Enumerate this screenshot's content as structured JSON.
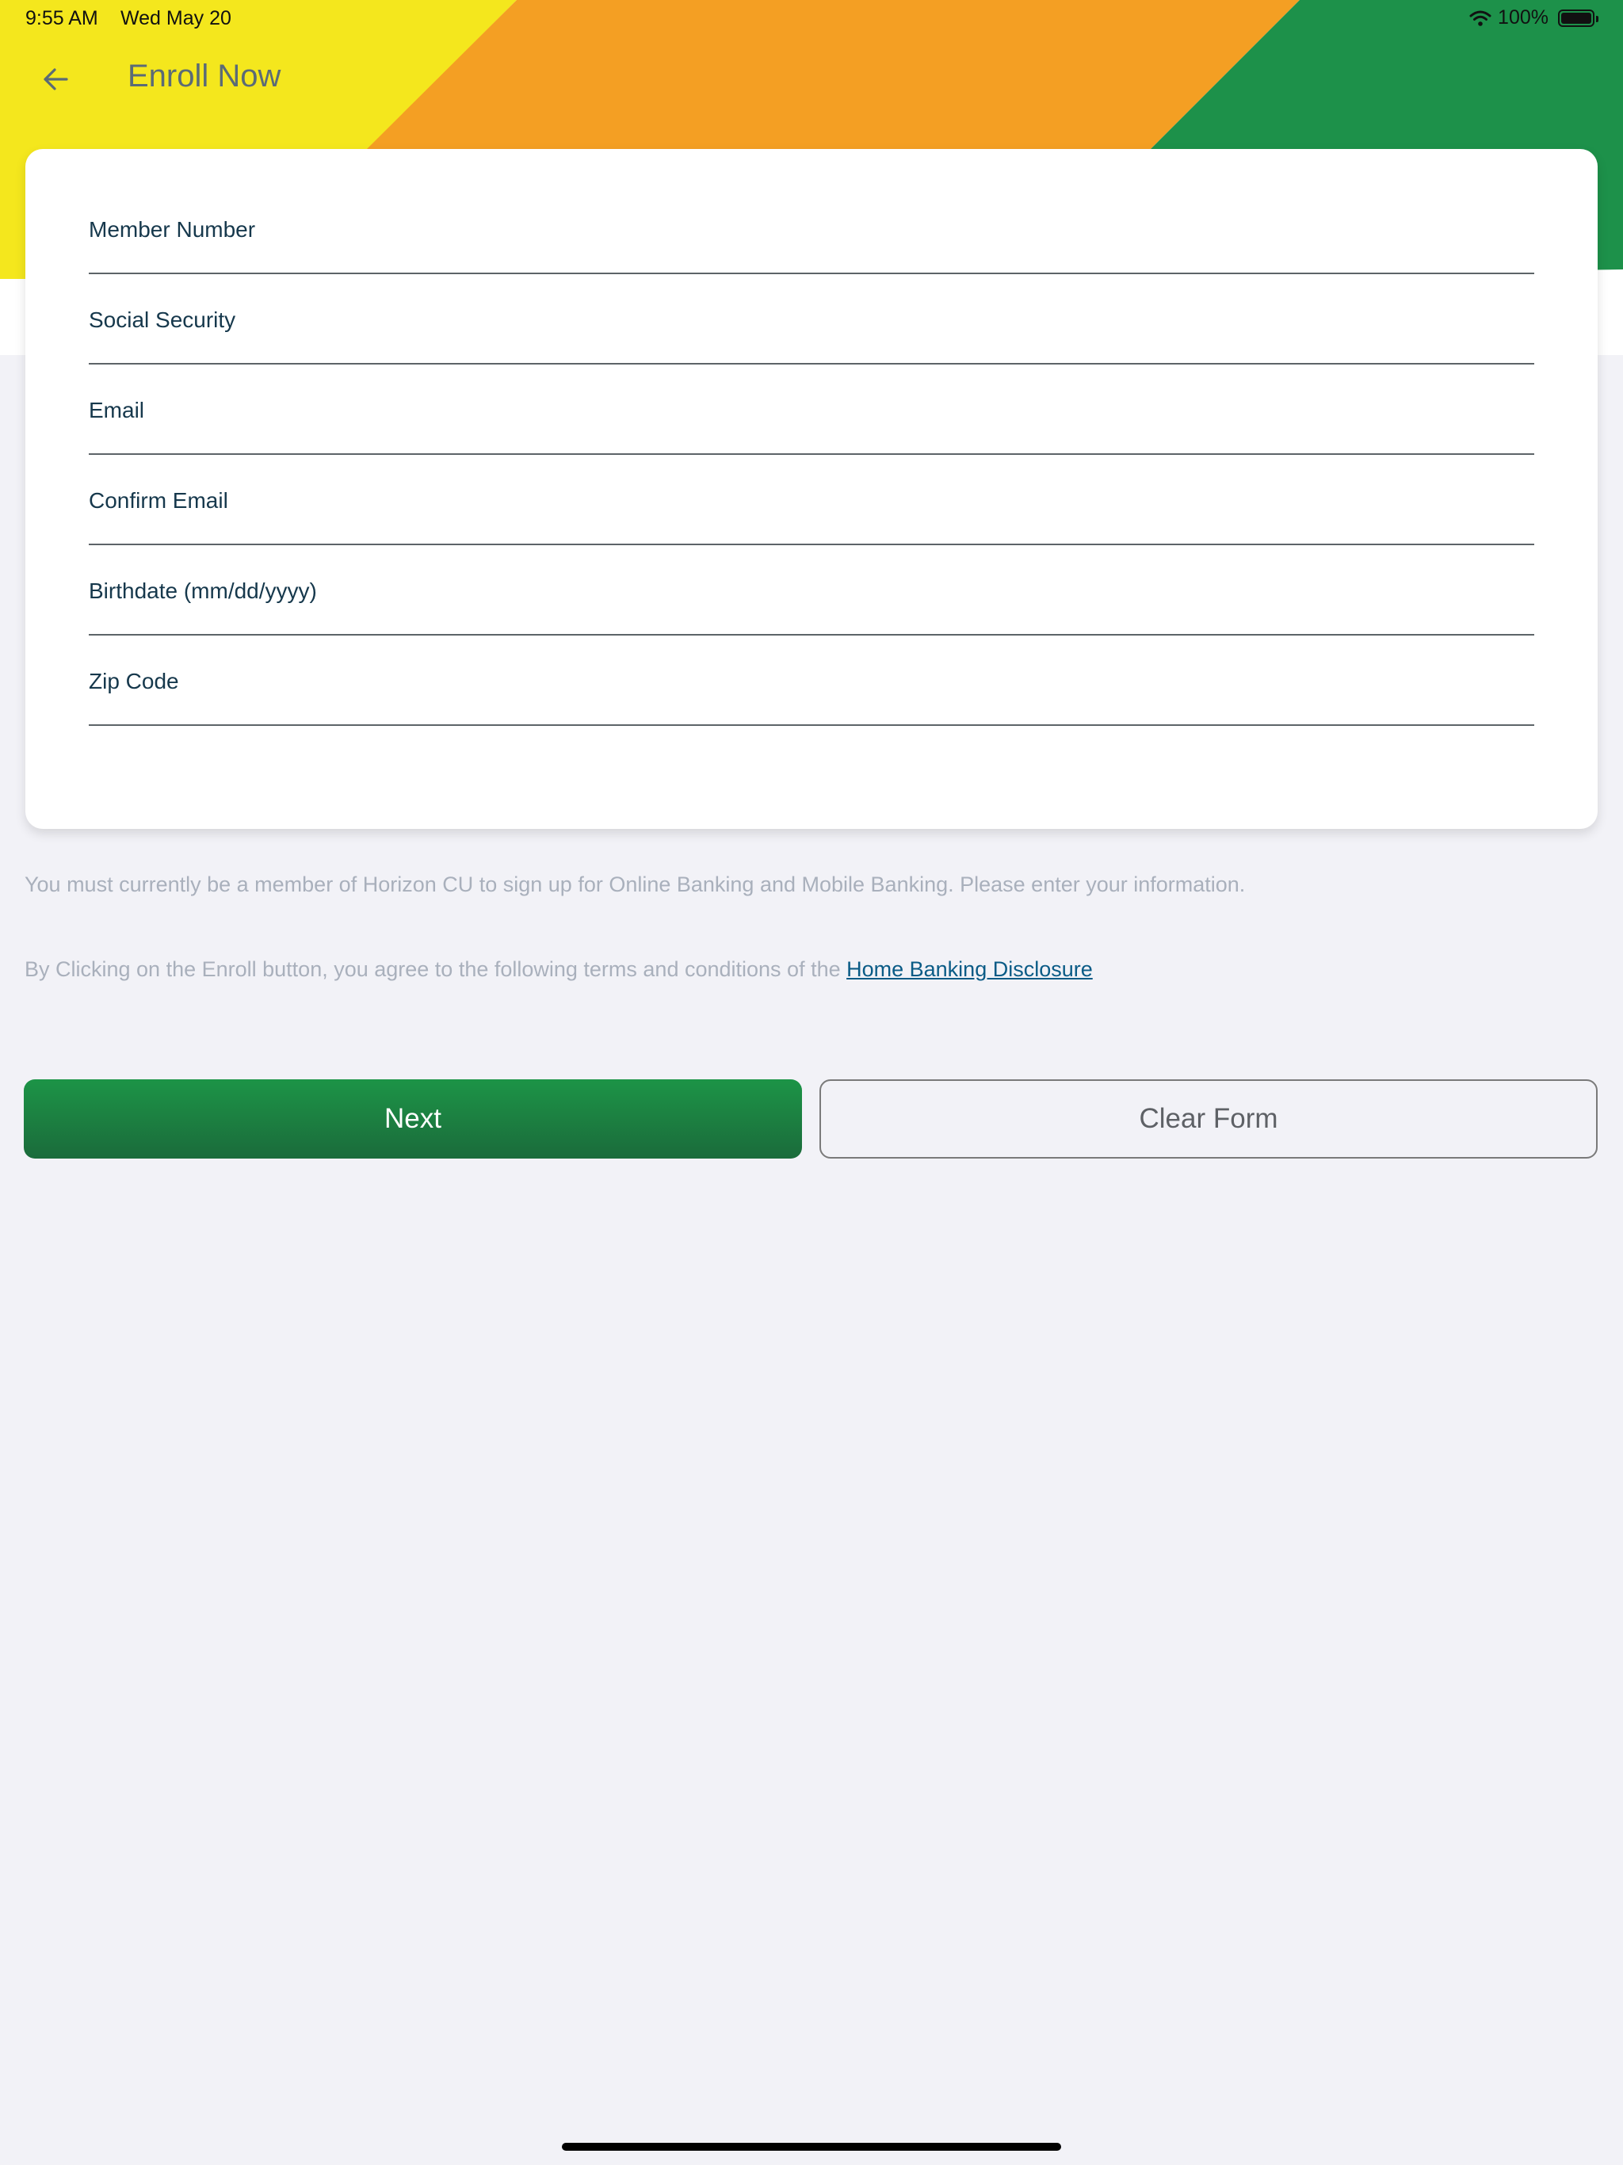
{
  "status_bar": {
    "time": "9:55 AM",
    "date": "Wed May 20",
    "battery": "100%",
    "wifi_icon": "wifi-icon",
    "battery_icon": "battery-icon"
  },
  "header": {
    "title": "Enroll Now",
    "back_icon": "arrow-left-icon"
  },
  "banner_colors": [
    "#f4e71d",
    "#f49f23",
    "#1d914a"
  ],
  "form": {
    "fields": [
      {
        "label": "Member Number",
        "value": ""
      },
      {
        "label": "Social Security",
        "value": ""
      },
      {
        "label": "Email",
        "value": ""
      },
      {
        "label": "Confirm Email",
        "value": ""
      },
      {
        "label": "Birthdate (mm/dd/yyyy)",
        "value": ""
      },
      {
        "label": "Zip Code",
        "value": ""
      }
    ]
  },
  "info": {
    "membership_note": "You must currently be a member of Horizon CU to sign up for Online Banking and Mobile Banking. Please enter your information.",
    "terms_prefix": "By Clicking on the Enroll button, you agree to the following terms and conditions of the ",
    "terms_link": "Home Banking Disclosure"
  },
  "buttons": {
    "next": "Next",
    "clear": "Clear Form"
  },
  "colors": {
    "primary_green": "#1c8a45",
    "link": "#0a5b86",
    "background": "#f2f2f7"
  }
}
